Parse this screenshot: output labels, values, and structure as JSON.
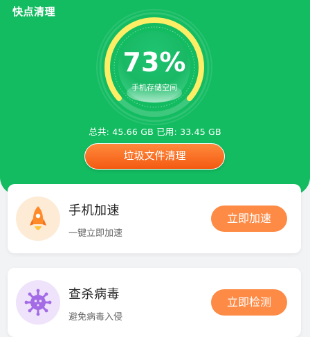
{
  "header": {
    "title": "快点清理"
  },
  "storage": {
    "percent_text": "73%",
    "percent_value": 73,
    "label": "手机存储空间",
    "total_label": "总共: ",
    "total_value": "45.66 GB",
    "used_label": "已用: ",
    "used_value": "33.45 GB"
  },
  "clean_button": {
    "label": "垃圾文件清理"
  },
  "cards": [
    {
      "title": "手机加速",
      "subtitle": "一键立即加速",
      "button_label": "立即加速",
      "icon": "rocket-icon"
    },
    {
      "title": "查杀病毒",
      "subtitle": "避免病毒入侵",
      "button_label": "立即检测",
      "icon": "virus-icon"
    }
  ],
  "colors": {
    "brand_green": "#13bc61",
    "gauge_yellow": "#fdee66",
    "button_orange": "#f45a12",
    "card_button_orange": "#fd8a45",
    "rocket_bg": "#fdebd6",
    "virus_bg": "#eee3fb"
  }
}
